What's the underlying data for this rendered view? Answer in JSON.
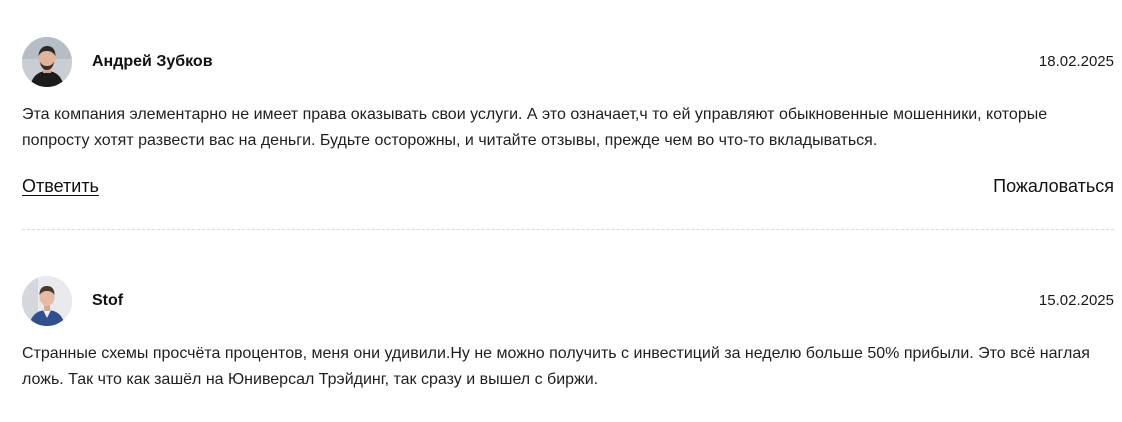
{
  "comments": [
    {
      "author": "Андрей Зубков",
      "date": "18.02.2025",
      "avatar_icon": "user-photo-dark-icon",
      "text": "Эта компания элементарно не имеет права оказывать свои услуги. А это означает,ч то ей управляют обыкновенные мошенники, которые попросту хотят развести вас на деньги. Будьте осторожны, и читайте отзывы, прежде чем во что-то вкладываться.",
      "reply_label": "Ответить",
      "report_label": "Пожаловаться"
    },
    {
      "author": "Stof",
      "date": "15.02.2025",
      "avatar_icon": "user-photo-blue-icon",
      "text": "Странные схемы просчёта процентов, меня они удивили.Ну не можно получить с инвестиций за неделю больше 50% прибыли. Это всё наглая ложь. Так что как зашёл на Юниверсал Трэйдинг, так сразу и вышел с биржи."
    }
  ],
  "colors": {
    "text": "#1a1a1a",
    "divider": "#d9d9d9",
    "background": "#ffffff"
  }
}
